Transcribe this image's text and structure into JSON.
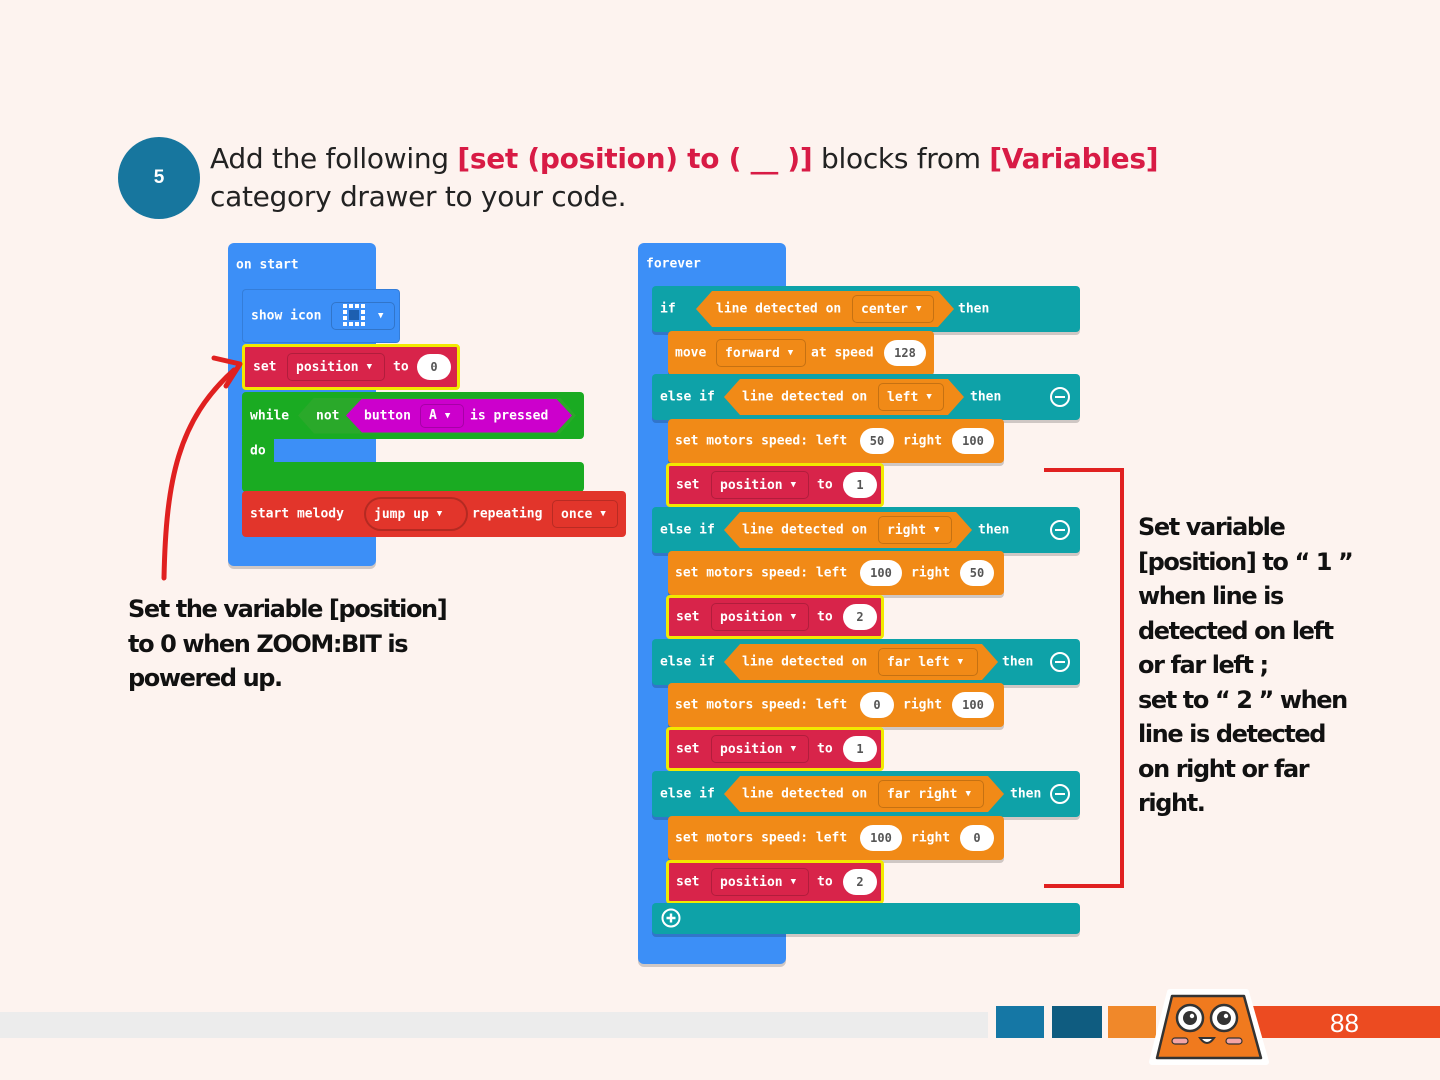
{
  "step": {
    "number": "5",
    "text_parts": [
      {
        "text": "Add the following ",
        "highlight": false
      },
      {
        "text": "[set (position) to ( __ )]",
        "highlight": true
      },
      {
        "text": " blocks from ",
        "highlight": false
      },
      {
        "text": "[Variables]",
        "highlight": true
      },
      {
        "text": " category drawer to your code.",
        "highlight": false
      }
    ]
  },
  "on_start": {
    "hat": "on start",
    "show_icon": "show icon",
    "set_kw": "set",
    "set_var": "position",
    "set_to": "to",
    "set_value": "0",
    "while_kw": "while",
    "not_kw": "not",
    "button_kw": "button",
    "button_val": "A",
    "is_pressed": "is pressed",
    "do_kw": "do",
    "melody_kw": "start melody",
    "melody_val": "jump up",
    "repeating_kw": "repeating",
    "repeating_val": "once"
  },
  "forever": {
    "hat": "forever",
    "if_kw": "if",
    "then_kw": "then",
    "else_if_kw": "else if",
    "line_detected": "line detected on",
    "center": "center",
    "move_kw": "move",
    "move_dir": "forward",
    "at_speed": "at speed",
    "speed_val": "128",
    "motors_kw": "set motors speed: left",
    "right_kw": "right",
    "set_kw": "set",
    "var": "position",
    "to_kw": "to",
    "branches": [
      {
        "cond": "left",
        "left": "50",
        "right": "100",
        "value": "1"
      },
      {
        "cond": "right",
        "left": "100",
        "right": "50",
        "value": "2"
      },
      {
        "cond": "far left",
        "left": "0",
        "right": "100",
        "value": "1"
      },
      {
        "cond": "far right",
        "left": "100",
        "right": "0",
        "value": "2"
      }
    ]
  },
  "caption_left": [
    "Set the variable [position]",
    "to 0 when ZOOM:BIT is",
    "powered up."
  ],
  "caption_right": [
    "Set variable",
    "[position] to “ 1 ”",
    "when line is",
    "detected on left",
    "or far left ;",
    "set to “ 2 ” when",
    "line is detected",
    "on right or far",
    "right."
  ],
  "page_number": "88",
  "colors": {
    "badge": "#17769e",
    "highlight": "#d81b45",
    "variables_block": "#d8244a",
    "annotation_red": "#e02020",
    "page_number_bar": "#ec4b21"
  }
}
